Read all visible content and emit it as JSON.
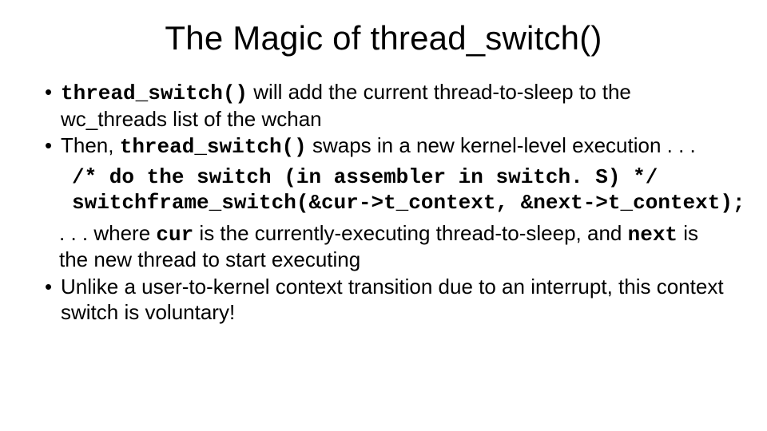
{
  "title": "The Magic of thread_switch()",
  "b1": {
    "code": "thread_switch()",
    "rest": " will add the current thread-to-sleep to the wc_threads list of the wchan"
  },
  "b2": {
    "pre": "Then, ",
    "code": "thread_switch()",
    "post": " swaps in a new kernel-level execution . . ."
  },
  "code": {
    "l1": "/* do the switch (in assembler in switch. S) */",
    "l2": "switchframe_switch(&cur->t_context, &next->t_context);"
  },
  "cont": {
    "a": ". . . where ",
    "cur": "cur",
    "b": " is the currently-executing thread-to-sleep, and ",
    "next": "next",
    "c": " is the new thread to start executing"
  },
  "b3": "Unlike a user-to-kernel context transition due to an interrupt, this context switch is voluntary!"
}
